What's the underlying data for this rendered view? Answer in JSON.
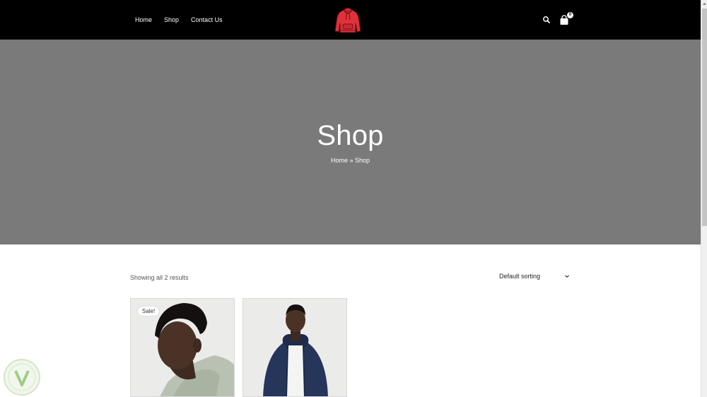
{
  "header": {
    "nav": [
      {
        "label": "Home"
      },
      {
        "label": "Shop"
      },
      {
        "label": "Contact Us"
      }
    ],
    "logo_icon": "red-hoodie-icon",
    "search_icon": "search-icon",
    "cart_icon": "shopping-bag-icon",
    "cart_count": "0"
  },
  "hero": {
    "title": "Shop",
    "breadcrumb": {
      "home": "Home",
      "separator": " » ",
      "current": "Shop"
    },
    "background_color": "#7a7a7a"
  },
  "shop": {
    "result_count": "Showing all 2 results",
    "sorting": {
      "selected": "Default sorting",
      "icon": "chevron-down-icon"
    },
    "products": [
      {
        "badge": "Sale!",
        "image": "man-in-sage-hoodie-photo"
      },
      {
        "badge": "",
        "image": "man-in-navy-zip-hoodie-photo"
      }
    ]
  },
  "colors": {
    "header_bg": "#000000",
    "logo_red": "#e0313b",
    "hero_bg": "#7a7a7a"
  }
}
